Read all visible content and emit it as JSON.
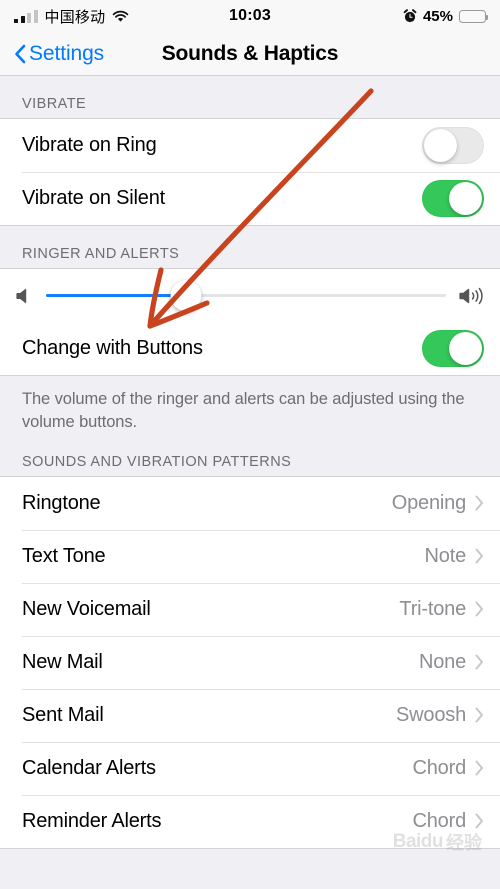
{
  "status_bar": {
    "carrier": "中国移动",
    "time": "10:03",
    "battery_percent": "45%",
    "signal_icon": "signal-bars-icon",
    "wifi_icon": "wifi-icon",
    "alarm_icon": "alarm-clock-icon",
    "battery_icon": "battery-icon",
    "battery_fill_color": "#F7CE46",
    "battery_level": 45
  },
  "nav_bar": {
    "back_label": "Settings",
    "back_icon": "chevron-left-icon",
    "title": "Sounds & Haptics",
    "accent_color": "#007AFF"
  },
  "sections": {
    "vibrate": {
      "header": "VIBRATE",
      "rows": [
        {
          "label": "Vibrate on Ring",
          "toggle": "off"
        },
        {
          "label": "Vibrate on Silent",
          "toggle": "on"
        }
      ]
    },
    "ringer": {
      "header": "RINGER AND ALERTS",
      "slider": {
        "value_percent": 35,
        "min_icon": "speaker-low-icon",
        "max_icon": "speaker-high-icon",
        "fill_color": "#147EFB"
      },
      "change_with_buttons": {
        "label": "Change with Buttons",
        "toggle": "on"
      },
      "footer": "The volume of the ringer and alerts can be adjusted using the volume buttons."
    },
    "patterns": {
      "header": "SOUNDS AND VIBRATION PATTERNS",
      "rows": [
        {
          "label": "Ringtone",
          "value": "Opening"
        },
        {
          "label": "Text Tone",
          "value": "Note"
        },
        {
          "label": "New Voicemail",
          "value": "Tri-tone"
        },
        {
          "label": "New Mail",
          "value": "None"
        },
        {
          "label": "Sent Mail",
          "value": "Swoosh"
        },
        {
          "label": "Calendar Alerts",
          "value": "Chord"
        },
        {
          "label": "Reminder Alerts",
          "value": "Chord"
        }
      ]
    }
  },
  "annotation": {
    "arrow_color": "#C8441E",
    "target": "ringer-volume-slider"
  },
  "watermark": {
    "brand": "Baidu",
    "suffix": "经验"
  },
  "toggle_colors": {
    "on": "#34C759",
    "off": "#E9E9EA"
  }
}
